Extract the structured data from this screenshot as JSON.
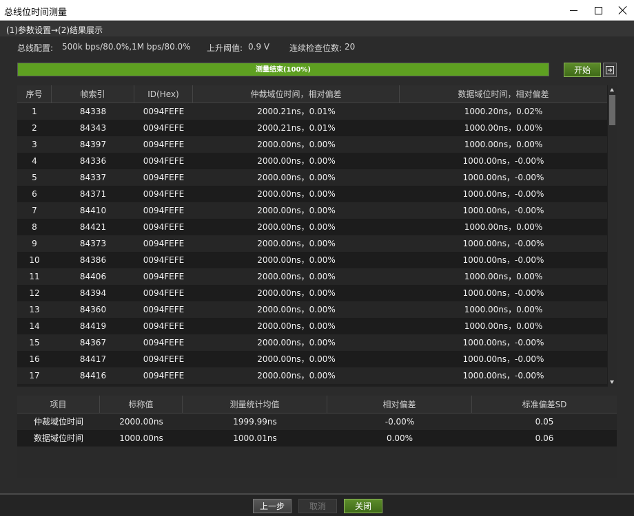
{
  "window": {
    "title": "总线位时间测量"
  },
  "steps": "(1)参数设置→(2)结果展示",
  "config": {
    "bus_label": "总线配置:",
    "bus_value": "500k bps/80.0%,1M bps/80.0%",
    "threshold_label": "上升阈值:",
    "threshold_value": "0.9 V",
    "consecutive_label": "连续检查位数:",
    "consecutive_value": "20"
  },
  "progress": {
    "text": "测量结束(100%)",
    "percent": 100,
    "color": "#5ea021"
  },
  "buttons": {
    "start": "开始",
    "export_icon": "export-icon",
    "prev": "上一步",
    "cancel": "取消",
    "close": "关闭"
  },
  "main_table": {
    "columns": [
      "序号",
      "帧索引",
      "ID(Hex)",
      "仲裁域位时间，相对偏差",
      "数据域位时间，相对偏差"
    ],
    "rows": [
      [
        "1",
        "84338",
        "0094FEFE",
        "2000.21ns，0.01%",
        "1000.20ns，0.02%"
      ],
      [
        "2",
        "84343",
        "0094FEFE",
        "2000.21ns，0.01%",
        "1000.00ns，0.00%"
      ],
      [
        "3",
        "84397",
        "0094FEFE",
        "2000.00ns，0.00%",
        "1000.00ns，0.00%"
      ],
      [
        "4",
        "84336",
        "0094FEFE",
        "2000.00ns，0.00%",
        "1000.00ns，-0.00%"
      ],
      [
        "5",
        "84337",
        "0094FEFE",
        "2000.00ns，0.00%",
        "1000.00ns，-0.00%"
      ],
      [
        "6",
        "84371",
        "0094FEFE",
        "2000.00ns，0.00%",
        "1000.00ns，-0.00%"
      ],
      [
        "7",
        "84410",
        "0094FEFE",
        "2000.00ns，0.00%",
        "1000.00ns，-0.00%"
      ],
      [
        "8",
        "84421",
        "0094FEFE",
        "2000.00ns，0.00%",
        "1000.00ns，0.00%"
      ],
      [
        "9",
        "84373",
        "0094FEFE",
        "2000.00ns，0.00%",
        "1000.00ns，-0.00%"
      ],
      [
        "10",
        "84386",
        "0094FEFE",
        "2000.00ns，0.00%",
        "1000.00ns，-0.00%"
      ],
      [
        "11",
        "84406",
        "0094FEFE",
        "2000.00ns，0.00%",
        "1000.00ns，0.00%"
      ],
      [
        "12",
        "84394",
        "0094FEFE",
        "2000.00ns，0.00%",
        "1000.00ns，-0.00%"
      ],
      [
        "13",
        "84360",
        "0094FEFE",
        "2000.00ns，0.00%",
        "1000.00ns，0.00%"
      ],
      [
        "14",
        "84419",
        "0094FEFE",
        "2000.00ns，0.00%",
        "1000.00ns，0.00%"
      ],
      [
        "15",
        "84367",
        "0094FEFE",
        "2000.00ns，0.00%",
        "1000.00ns，-0.00%"
      ],
      [
        "16",
        "84417",
        "0094FEFE",
        "2000.00ns，0.00%",
        "1000.00ns，-0.00%"
      ],
      [
        "17",
        "84416",
        "0094FEFE",
        "2000.00ns，0.00%",
        "1000.00ns，-0.00%"
      ]
    ]
  },
  "summary_table": {
    "columns": [
      "项目",
      "标称值",
      "测量统计均值",
      "相对偏差",
      "标准偏差SD"
    ],
    "rows": [
      [
        "仲裁域位时间",
        "2000.00ns",
        "1999.99ns",
        "-0.00%",
        "0.05"
      ],
      [
        "数据域位时间",
        "1000.00ns",
        "1000.01ns",
        "0.00%",
        "0.06"
      ]
    ]
  }
}
